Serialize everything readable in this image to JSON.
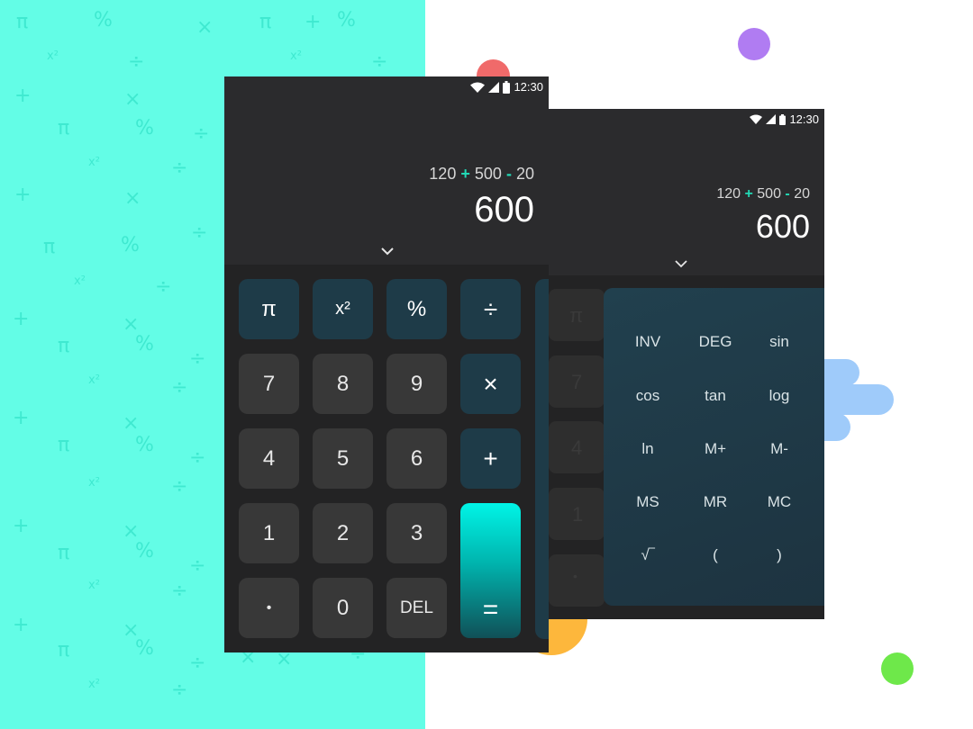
{
  "background_symbols": [
    "π",
    "%",
    "×",
    "π",
    "+",
    "%",
    "x²",
    "÷",
    "x²",
    "÷",
    "+",
    "×",
    "π",
    "%",
    "÷",
    "x²",
    "÷",
    "+",
    "×",
    "π",
    "%",
    "÷",
    "x²",
    "÷",
    "+",
    "×",
    "π",
    "%",
    "÷",
    "x²",
    "÷",
    "+",
    "×",
    "π",
    "%",
    "÷",
    "x²",
    "÷",
    "+",
    "×",
    "π",
    "%",
    "÷",
    "x²",
    "÷",
    "+",
    "×",
    "π",
    "%",
    "÷",
    "x²",
    "÷",
    "×",
    "×",
    "÷"
  ],
  "colors": {
    "background_teal": "#63fde6",
    "symbol": "#3fe9d0",
    "phone": "#2b2b2d",
    "accent": "#22d9b5",
    "operator_key": "#1e3b48",
    "dot_red": "#f06a6a",
    "dot_purple": "#b07cf2",
    "dot_orange": "#fdb73c",
    "dot_green": "#6ee84a",
    "cloud_blue": "#9fcbfa"
  },
  "front_phone": {
    "status_time": "12:30",
    "expression": {
      "a": "120",
      "op1": "+",
      "b": "500",
      "op2": "-",
      "c": "20"
    },
    "result": "600",
    "keys": {
      "pi": "π",
      "square": "x²",
      "percent": "%",
      "divide": "÷",
      "seven": "7",
      "eight": "8",
      "nine": "9",
      "multiply": "×",
      "four": "4",
      "five": "5",
      "six": "6",
      "plus": "+",
      "one": "1",
      "two": "2",
      "three": "3",
      "equals": "=",
      "dot": "•",
      "zero": "0",
      "del": "DEL"
    }
  },
  "back_phone": {
    "status_time": "12:30",
    "expression": {
      "a": "120",
      "op1": "+",
      "b": "500",
      "op2": "-",
      "c": "20"
    },
    "result": "600",
    "faded_keys": {
      "pi": "π",
      "seven": "7",
      "four": "4",
      "one": "1",
      "dot": "•"
    },
    "scientific_panel": [
      [
        "INV",
        "DEG",
        "sin"
      ],
      [
        "cos",
        "tan",
        "log"
      ],
      [
        "ln",
        "M+",
        "M-"
      ],
      [
        "MS",
        "MR",
        "MC"
      ],
      [
        "√‾",
        "(",
        ")"
      ]
    ]
  }
}
